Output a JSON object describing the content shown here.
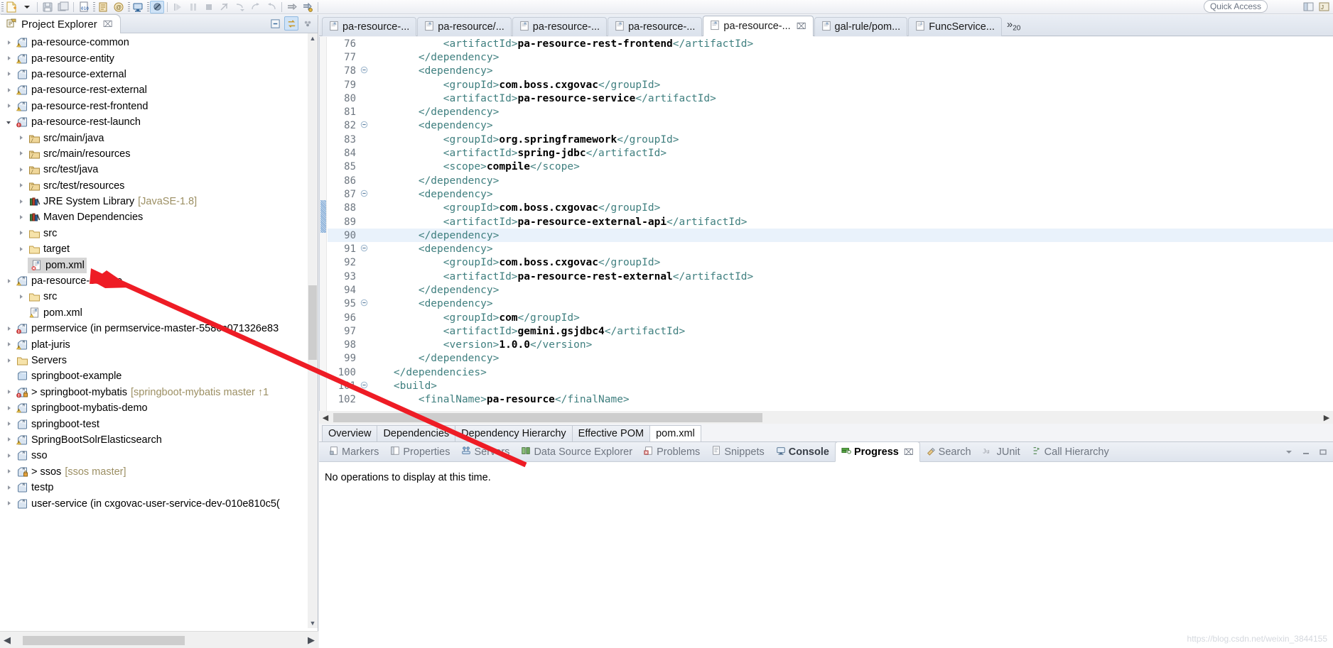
{
  "toolbar": {
    "quick_access_placeholder": "Quick Access",
    "buttons": [
      {
        "name": "new-wizard",
        "label": "New"
      },
      {
        "name": "new-dropdown",
        "label": "New drop-down"
      },
      {
        "name": "save",
        "label": "Save"
      },
      {
        "name": "save-all",
        "label": "Save All"
      },
      {
        "name": "new-java-class",
        "label": "New Java Class"
      },
      {
        "name": "new-annotation",
        "label": "New Annotation"
      },
      {
        "name": "new-package",
        "label": "New Package"
      },
      {
        "name": "open-console",
        "label": "Open Console"
      },
      {
        "name": "skip-breakpoints",
        "label": "Skip All Breakpoints"
      },
      {
        "name": "resume",
        "label": "Resume"
      },
      {
        "name": "suspend",
        "label": "Suspend"
      },
      {
        "name": "terminate",
        "label": "Terminate"
      },
      {
        "name": "disconnect",
        "label": "Disconnect"
      },
      {
        "name": "step-into",
        "label": "Step Into"
      },
      {
        "name": "step-over",
        "label": "Step Over"
      },
      {
        "name": "step-return",
        "label": "Step Return"
      },
      {
        "name": "run-last",
        "label": "Run Last Tool"
      },
      {
        "name": "external-tools",
        "label": "External Tools"
      }
    ]
  },
  "project_explorer": {
    "title": "Project Explorer",
    "close_label": "⌧",
    "tools": [
      {
        "name": "collapse-all",
        "label": "Collapse All"
      },
      {
        "name": "link-with-editor",
        "label": "Link with Editor"
      },
      {
        "name": "view-menu",
        "label": "View Menu"
      }
    ],
    "tree": [
      {
        "depth": 0,
        "arrow": "right",
        "icon": "maven-project-warning",
        "label": "pa-resource-common",
        "sub": ""
      },
      {
        "depth": 0,
        "arrow": "right",
        "icon": "maven-project-warning",
        "label": "pa-resource-entity",
        "sub": ""
      },
      {
        "depth": 0,
        "arrow": "right",
        "icon": "maven-project",
        "label": "pa-resource-external",
        "sub": ""
      },
      {
        "depth": 0,
        "arrow": "right",
        "icon": "maven-project-warning",
        "label": "pa-resource-rest-external",
        "sub": ""
      },
      {
        "depth": 0,
        "arrow": "right",
        "icon": "maven-project-warning",
        "label": "pa-resource-rest-frontend",
        "sub": ""
      },
      {
        "depth": 0,
        "arrow": "down",
        "icon": "maven-project-error",
        "label": "pa-resource-rest-launch",
        "sub": ""
      },
      {
        "depth": 1,
        "arrow": "right",
        "icon": "source-folder",
        "label": "src/main/java",
        "sub": ""
      },
      {
        "depth": 1,
        "arrow": "right",
        "icon": "source-folder",
        "label": "src/main/resources",
        "sub": ""
      },
      {
        "depth": 1,
        "arrow": "right",
        "icon": "source-folder",
        "label": "src/test/java",
        "sub": ""
      },
      {
        "depth": 1,
        "arrow": "right",
        "icon": "source-folder",
        "label": "src/test/resources",
        "sub": ""
      },
      {
        "depth": 1,
        "arrow": "right",
        "icon": "library",
        "label": "JRE System Library",
        "sub": "[JavaSE-1.8]"
      },
      {
        "depth": 1,
        "arrow": "right",
        "icon": "library",
        "label": "Maven Dependencies",
        "sub": ""
      },
      {
        "depth": 1,
        "arrow": "right",
        "icon": "folder",
        "label": "src",
        "sub": ""
      },
      {
        "depth": 1,
        "arrow": "right",
        "icon": "folder",
        "label": "target",
        "sub": ""
      },
      {
        "depth": 1,
        "arrow": "none",
        "icon": "pom-error",
        "label": "pom.xml",
        "sub": "",
        "selected": true
      },
      {
        "depth": 0,
        "arrow": "right",
        "icon": "maven-project-warning",
        "label": "pa-resource-service",
        "sub": ""
      },
      {
        "depth": 1,
        "arrow": "right",
        "icon": "folder",
        "label": "src",
        "sub": ""
      },
      {
        "depth": 1,
        "arrow": "none",
        "icon": "pom-warning",
        "label": "pom.xml",
        "sub": ""
      },
      {
        "depth": 0,
        "arrow": "right",
        "icon": "maven-project-error",
        "label": "permservice (in permservice-master-5586c071326e83",
        "sub": ""
      },
      {
        "depth": 0,
        "arrow": "right",
        "icon": "maven-project-warning",
        "label": "plat-juris",
        "sub": ""
      },
      {
        "depth": 0,
        "arrow": "right",
        "icon": "folder",
        "label": "Servers",
        "sub": ""
      },
      {
        "depth": 0,
        "arrow": "none",
        "icon": "closed-project",
        "label": "springboot-example",
        "sub": ""
      },
      {
        "depth": 0,
        "arrow": "right",
        "icon": "maven-project-error-lock",
        "label": "> springboot-mybatis",
        "sub": "[springboot-mybatis master ↑1"
      },
      {
        "depth": 0,
        "arrow": "right",
        "icon": "maven-project-warning",
        "label": "springboot-mybatis-demo",
        "sub": ""
      },
      {
        "depth": 0,
        "arrow": "right",
        "icon": "maven-project",
        "label": "springboot-test",
        "sub": ""
      },
      {
        "depth": 0,
        "arrow": "right",
        "icon": "maven-project-warning",
        "label": "SpringBootSolrElasticsearch",
        "sub": ""
      },
      {
        "depth": 0,
        "arrow": "right",
        "icon": "maven-project",
        "label": "sso",
        "sub": ""
      },
      {
        "depth": 0,
        "arrow": "right",
        "icon": "maven-project-lock",
        "label": "> ssos",
        "sub": "[ssos master]"
      },
      {
        "depth": 0,
        "arrow": "right",
        "icon": "maven-project",
        "label": "testp",
        "sub": ""
      },
      {
        "depth": 0,
        "arrow": "right",
        "icon": "maven-project",
        "label": "user-service (in cxgovac-user-service-dev-010e810c5(",
        "sub": ""
      }
    ]
  },
  "editor": {
    "tabs": [
      {
        "label": "pa-resource-...",
        "icon": "maven-pom-file",
        "active": false,
        "closable": false
      },
      {
        "label": "pa-resource/...",
        "icon": "maven-pom-file",
        "active": false,
        "closable": false
      },
      {
        "label": "pa-resource-...",
        "icon": "maven-pom-file",
        "active": false,
        "closable": false
      },
      {
        "label": "pa-resource-...",
        "icon": "maven-pom-file",
        "active": false,
        "closable": false
      },
      {
        "label": "pa-resource-...",
        "icon": "maven-pom-file",
        "active": true,
        "closable": true
      },
      {
        "label": "gal-rule/pom...",
        "icon": "maven-pom-file",
        "active": false,
        "closable": false
      },
      {
        "label": "FuncService...",
        "icon": "java-file",
        "active": false,
        "closable": false
      }
    ],
    "more_tabs_label": "»",
    "more_tabs_count": "20",
    "code_lines": [
      {
        "num": "76",
        "fold": "",
        "indent": 12,
        "text": "<artifactId>pa-resource-rest-frontend</artifactId>",
        "hl": false,
        "squiggle": "frontend"
      },
      {
        "num": "77",
        "fold": "",
        "indent": 8,
        "text": "</dependency>",
        "hl": false
      },
      {
        "num": "78",
        "fold": "minus",
        "indent": 8,
        "text": "<dependency>",
        "hl": false
      },
      {
        "num": "79",
        "fold": "",
        "indent": 12,
        "text": "<groupId>com.boss.cxgovac</groupId>",
        "hl": false
      },
      {
        "num": "80",
        "fold": "",
        "indent": 12,
        "text": "<artifactId>pa-resource-service</artifactId>",
        "hl": false
      },
      {
        "num": "81",
        "fold": "",
        "indent": 8,
        "text": "</dependency>",
        "hl": false
      },
      {
        "num": "82",
        "fold": "minus",
        "indent": 8,
        "text": "<dependency>",
        "hl": false
      },
      {
        "num": "83",
        "fold": "",
        "indent": 12,
        "text": "<groupId>org.springframework</groupId>",
        "hl": false
      },
      {
        "num": "84",
        "fold": "",
        "indent": 12,
        "text": "<artifactId>spring-jdbc</artifactId>",
        "hl": false
      },
      {
        "num": "85",
        "fold": "",
        "indent": 12,
        "text": "<scope>compile</scope>",
        "hl": false
      },
      {
        "num": "86",
        "fold": "",
        "indent": 8,
        "text": "</dependency>",
        "hl": false
      },
      {
        "num": "87",
        "fold": "minus",
        "indent": 8,
        "text": "<dependency>",
        "hl": false
      },
      {
        "num": "88",
        "fold": "",
        "indent": 12,
        "text": "<groupId>com.boss.cxgovac</groupId>",
        "hl": false
      },
      {
        "num": "89",
        "fold": "",
        "indent": 12,
        "text": "<artifactId>pa-resource-external-api</artifactId>",
        "hl": false,
        "squiggle": "api"
      },
      {
        "num": "90",
        "fold": "",
        "indent": 8,
        "text": "</dependency>",
        "hl": true
      },
      {
        "num": "91",
        "fold": "minus",
        "indent": 8,
        "text": "<dependency>",
        "hl": false
      },
      {
        "num": "92",
        "fold": "",
        "indent": 12,
        "text": "<groupId>com.boss.cxgovac</groupId>",
        "hl": false
      },
      {
        "num": "93",
        "fold": "",
        "indent": 12,
        "text": "<artifactId>pa-resource-rest-external</artifactId>",
        "hl": false
      },
      {
        "num": "94",
        "fold": "",
        "indent": 8,
        "text": "</dependency>",
        "hl": false
      },
      {
        "num": "95",
        "fold": "minus",
        "indent": 8,
        "text": "<dependency>",
        "hl": false
      },
      {
        "num": "96",
        "fold": "",
        "indent": 12,
        "text": "<groupId>com</groupId>",
        "hl": false,
        "squiggle": "com"
      },
      {
        "num": "97",
        "fold": "",
        "indent": 12,
        "text": "<artifactId>gemini.gsjdbc4</artifactId>",
        "hl": false
      },
      {
        "num": "98",
        "fold": "",
        "indent": 12,
        "text": "<version>1.0.0</version>",
        "hl": false
      },
      {
        "num": "99",
        "fold": "",
        "indent": 8,
        "text": "</dependency>",
        "hl": false
      },
      {
        "num": "100",
        "fold": "",
        "indent": 4,
        "text": "</dependencies>",
        "hl": false
      },
      {
        "num": "101",
        "fold": "minus",
        "indent": 4,
        "text": "<build>",
        "hl": false
      },
      {
        "num": "102",
        "fold": "",
        "indent": 8,
        "text": "<finalName>pa-resource</finalName>",
        "hl": false
      }
    ],
    "form_tabs": [
      {
        "label": "Overview",
        "active": false
      },
      {
        "label": "Dependencies",
        "active": false
      },
      {
        "label": "Dependency Hierarchy",
        "active": false
      },
      {
        "label": "Effective POM",
        "active": false
      },
      {
        "label": "pom.xml",
        "active": true
      }
    ]
  },
  "bottom_panel": {
    "tabs": [
      {
        "label": "Markers",
        "icon": "marker-icon",
        "active": false,
        "bold": false
      },
      {
        "label": "Properties",
        "icon": "properties-icon",
        "active": false,
        "bold": false
      },
      {
        "label": "Servers",
        "icon": "servers-icon",
        "active": false,
        "bold": false
      },
      {
        "label": "Data Source Explorer",
        "icon": "datasource-icon",
        "active": false,
        "bold": false
      },
      {
        "label": "Problems",
        "icon": "problems-icon",
        "active": false,
        "bold": false
      },
      {
        "label": "Snippets",
        "icon": "snippets-icon",
        "active": false,
        "bold": false
      },
      {
        "label": "Console",
        "icon": "console-icon",
        "active": false,
        "bold": true
      },
      {
        "label": "Progress",
        "icon": "progress-icon",
        "active": true,
        "bold": true
      },
      {
        "label": "Search",
        "icon": "search-icon",
        "active": false,
        "bold": false
      },
      {
        "label": "JUnit",
        "icon": "junit-icon",
        "active": false,
        "bold": false
      },
      {
        "label": "Call Hierarchy",
        "icon": "call-hierarchy-icon",
        "active": false,
        "bold": false
      }
    ],
    "close_label": "⌧",
    "message": "No operations to display at this time.",
    "right_tools": [
      {
        "name": "view-menu",
        "label": "▽"
      },
      {
        "name": "minimize",
        "label": "–"
      },
      {
        "name": "maximize",
        "label": "▭"
      }
    ]
  },
  "watermark": "https://blog.csdn.net/weixin_3844155",
  "colors": {
    "xml_tag": "#3f7f7f",
    "xml_value": "#000000",
    "selection_line": "#e9f2fb",
    "arrow_red": "#ee1c25",
    "tree_sub": "#9c8f63",
    "accent_blue": "#cfe3f7"
  }
}
